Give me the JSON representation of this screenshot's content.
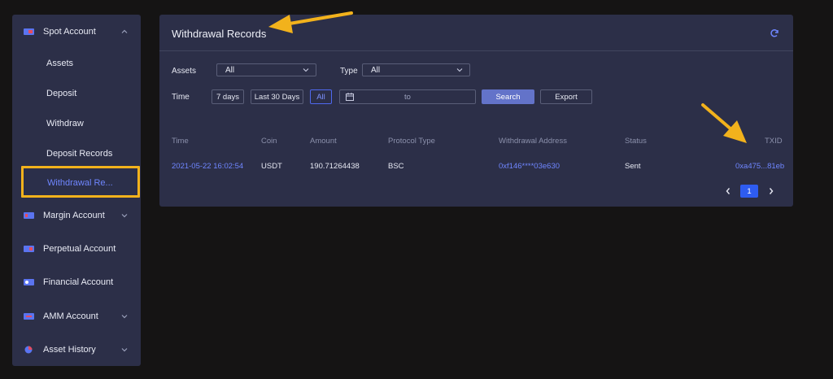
{
  "sidebar": {
    "sections": [
      {
        "label": "Spot Account",
        "icon": "wallet-icon",
        "expanded": true
      },
      {
        "label": "Margin Account",
        "icon": "margin-icon",
        "expanded": false
      },
      {
        "label": "Perpetual Account",
        "icon": "perpetual-icon",
        "expanded": false
      },
      {
        "label": "Financial Account",
        "icon": "financial-icon",
        "expanded": false
      },
      {
        "label": "AMM Account",
        "icon": "amm-icon",
        "expanded": false
      },
      {
        "label": "Asset History",
        "icon": "history-icon",
        "expanded": false
      }
    ],
    "spot_items": [
      "Assets",
      "Deposit",
      "Withdraw",
      "Deposit Records",
      "Withdrawal Re..."
    ],
    "active_item": "Withdrawal Re..."
  },
  "panel": {
    "title": "Withdrawal Records",
    "filters": {
      "assets_label": "Assets",
      "assets_value": "All",
      "type_label": "Type",
      "type_value": "All",
      "time_label": "Time",
      "time_buttons": [
        "7 days",
        "Last 30 Days",
        "All"
      ],
      "active_time": "All",
      "date_separator": "to",
      "search_label": "Search",
      "export_label": "Export"
    },
    "table": {
      "columns": [
        "Time",
        "Coin",
        "Amount",
        "Protocol Type",
        "Withdrawal Address",
        "Status",
        "TXID"
      ],
      "rows": [
        {
          "time": "2021-05-22 16:02:54",
          "coin": "USDT",
          "amount": "190.71264438",
          "protocol": "BSC",
          "address": "0xf146****03e630",
          "status": "Sent",
          "txid": "0xa475...81eb"
        }
      ]
    },
    "pagination": {
      "current_page": "1"
    }
  },
  "colors": {
    "background": "#151414",
    "panel": "#2c2f48",
    "accent": "#6f86ff",
    "highlight": "#f2b21c",
    "page_active": "#2e5cf0"
  }
}
